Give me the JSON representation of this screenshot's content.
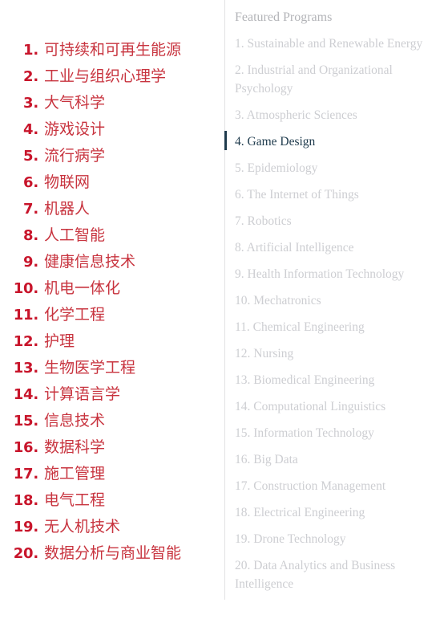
{
  "colors": {
    "number_red": "#c8152b",
    "label_red": "#c8343f",
    "english_grey": "#cdced2",
    "heading_grey": "#b3b4b8",
    "active_navy": "#1f3b4d",
    "divider_grey": "#e2e2e4",
    "background": "#ffffff"
  },
  "left_column": {
    "name": "chinese-program-list",
    "items": [
      {
        "number": "1.",
        "label": "可持续和可再生能源"
      },
      {
        "number": "2.",
        "label": "工业与组织心理学"
      },
      {
        "number": "3.",
        "label": "大气科学"
      },
      {
        "number": "4.",
        "label": "游戏设计"
      },
      {
        "number": "5.",
        "label": "流行病学"
      },
      {
        "number": "6.",
        "label": "物联网"
      },
      {
        "number": "7.",
        "label": "机器人"
      },
      {
        "number": "8.",
        "label": "人工智能"
      },
      {
        "number": "9.",
        "label": "健康信息技术"
      },
      {
        "number": "10.",
        "label": "机电一体化"
      },
      {
        "number": "11.",
        "label": "化学工程"
      },
      {
        "number": "12.",
        "label": "护理"
      },
      {
        "number": "13.",
        "label": "生物医学工程"
      },
      {
        "number": "14.",
        "label": "计算语言学"
      },
      {
        "number": "15.",
        "label": "信息技术"
      },
      {
        "number": "16.",
        "label": "数据科学"
      },
      {
        "number": "17.",
        "label": "施工管理"
      },
      {
        "number": "18.",
        "label": "电气工程"
      },
      {
        "number": "19.",
        "label": "无人机技术"
      },
      {
        "number": "20.",
        "label": "数据分析与商业智能"
      }
    ]
  },
  "right_column": {
    "name": "featured-programs-list",
    "heading": "Featured Programs",
    "active_index": 3,
    "items": [
      {
        "text": "1. Sustainable and Renewable Energy"
      },
      {
        "text": "2. Industrial and Organizational Psychology"
      },
      {
        "text": "3. Atmospheric Sciences"
      },
      {
        "text": "4. Game Design"
      },
      {
        "text": "5. Epidemiology"
      },
      {
        "text": "6. The Internet of Things"
      },
      {
        "text": "7. Robotics"
      },
      {
        "text": "8. Artificial Intelligence"
      },
      {
        "text": "9. Health Information Technology"
      },
      {
        "text": "10. Mechatronics"
      },
      {
        "text": "11. Chemical Engineering"
      },
      {
        "text": "12. Nursing"
      },
      {
        "text": "13. Biomedical Engineering"
      },
      {
        "text": "14. Computational Linguistics"
      },
      {
        "text": "15. Information Technology"
      },
      {
        "text": "16. Big Data"
      },
      {
        "text": "17. Construction Management"
      },
      {
        "text": "18. Electrical Engineering"
      },
      {
        "text": "19. Drone Technology"
      },
      {
        "text": "20. Data Analytics and Business Intelligence"
      }
    ]
  }
}
